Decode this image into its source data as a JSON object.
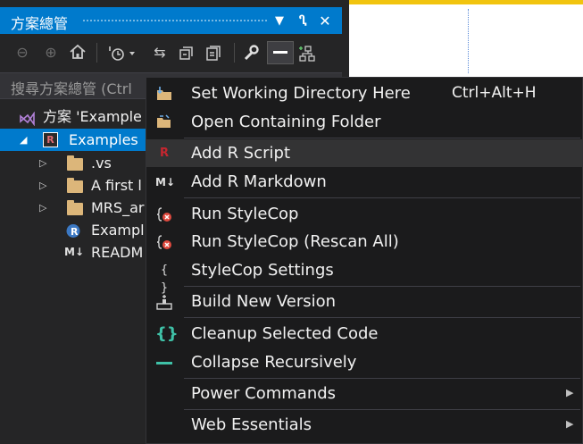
{
  "panel": {
    "title": "方案總管",
    "pin_glyph": "Ⴂ",
    "search_placeholder": "搜尋方案總管 (Ctrl",
    "toolbar_icons": [
      "back-icon",
      "forward-icon",
      "home-icon",
      "history-icon",
      "sync-icon",
      "collapse-all-icon",
      "properties-icon",
      "wrench-icon",
      "preview-icon",
      "solution-icon"
    ]
  },
  "tree": {
    "solution_label": "方案 'Example",
    "project_label": "Examples",
    "project_badge": "R",
    "items": [
      {
        "label": ".vs",
        "icon": "folder-icon"
      },
      {
        "label": "A first l",
        "icon": "folder-icon"
      },
      {
        "label": "MRS_ar",
        "icon": "folder-icon"
      },
      {
        "label": "Exampl",
        "icon": "r-project-icon"
      },
      {
        "label": "READM",
        "icon": "markdown-icon"
      }
    ]
  },
  "menu": {
    "items": [
      {
        "label": "Set Working Directory Here",
        "shortcut": "Ctrl+Alt+H",
        "icon": "folder-arrow-icon"
      },
      {
        "label": "Open Containing Folder",
        "shortcut": "",
        "icon": "open-folder-icon"
      },
      {
        "label": "Add R Script",
        "shortcut": "",
        "icon": "r-script-icon",
        "badge": "R"
      },
      {
        "label": "Add R Markdown",
        "shortcut": "",
        "icon": "r-markdown-icon",
        "badge": "M↓"
      },
      {
        "label": "Run StyleCop",
        "shortcut": "",
        "icon": "stylecop-icon"
      },
      {
        "label": "Run StyleCop (Rescan All)",
        "shortcut": "",
        "icon": "stylecop-rescan-icon"
      },
      {
        "label": "StyleCop Settings",
        "shortcut": "",
        "icon": "braces-icon",
        "badge": "{ }"
      },
      {
        "label": "Build New Version",
        "shortcut": "",
        "icon": "build-icon"
      },
      {
        "label": "Cleanup Selected Code",
        "shortcut": "",
        "icon": "cleanup-braces-icon",
        "badge": "{}"
      },
      {
        "label": "Collapse Recursively",
        "shortcut": "",
        "icon": "collapse-icon"
      },
      {
        "label": "Power Commands",
        "shortcut": "",
        "icon": "",
        "submenu": "▶"
      },
      {
        "label": "Web Essentials",
        "shortcut": "",
        "icon": "",
        "submenu": "▶"
      }
    ]
  },
  "colors": {
    "accent": "#007acc",
    "menu_bg": "#1b1b1c",
    "highlight": "#333334",
    "r_red": "#c5262f",
    "cleanup_green": "#3fc1a7"
  }
}
